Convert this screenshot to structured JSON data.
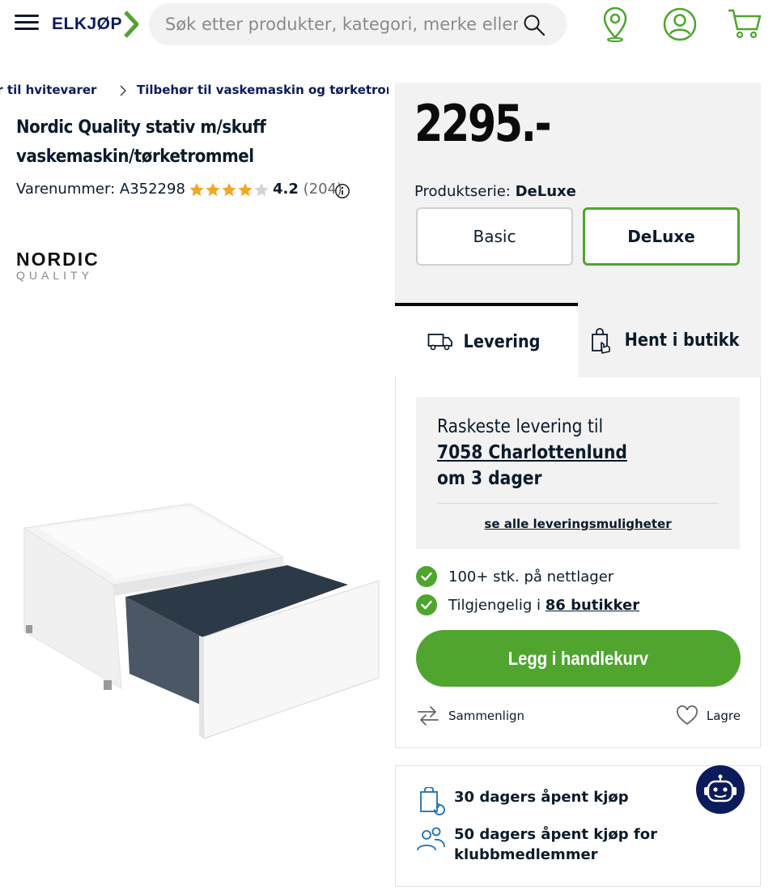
{
  "header": {
    "logo_text": "ELKJØP",
    "search_placeholder": "Søk etter produkter, kategori, merke eller artik"
  },
  "breadcrumb": {
    "items": [
      "Tilbehør til hvitevarer",
      "Tilbehør til vaskemaskin og tørketrommel"
    ],
    "visible_first": "ør til hvitevarer"
  },
  "product": {
    "title_line1": "Nordic Quality stativ m/skuff",
    "title_line2": "vaskemaskin/tørketrommel",
    "sku_label": "Varenummer:",
    "sku_value": "A352298",
    "rating_value": "4.2",
    "rating_count": "(204)",
    "rating_stars": 4.2,
    "brand_top": "NORDIC",
    "brand_bottom": "QUALITY"
  },
  "purchase": {
    "price": "2295.-",
    "series_label": "Produktserie:",
    "series_value": "DeLuxe",
    "options": [
      "Basic",
      "DeLuxe"
    ],
    "tab_delivery": "Levering",
    "tab_pickup": "Hent i butikk",
    "delivery_line1": "Raskeste levering til",
    "delivery_location": "7058 Charlottenlund",
    "delivery_eta": "om 3 dager",
    "delivery_link": "se alle leveringsmuligheter",
    "stock_online": "100+ stk. på nettlager",
    "stock_stores_prefix": "Tilgjengelig i",
    "stock_stores_link": "86 butikker",
    "add_to_cart": "Legg i handlekurv",
    "compare": "Sammenlign",
    "save": "Lagre"
  },
  "returns": {
    "line1": "30 dagers åpent kjøp",
    "line2a": "50 dagers åpent kjøp for",
    "line2b": "klubbmedlemmer"
  },
  "colors": {
    "accent_green": "#4fa52e",
    "navy": "#0b1b5b",
    "star": "#f5a623",
    "panel_bg": "#f2f2f2"
  }
}
